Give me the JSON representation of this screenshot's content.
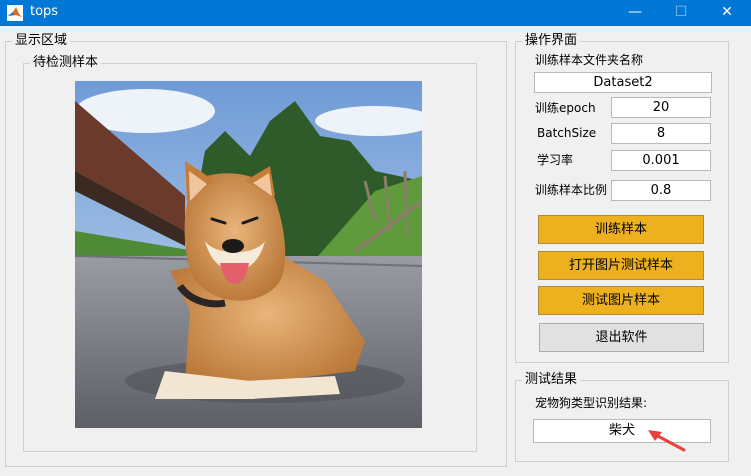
{
  "window": {
    "title": "tops",
    "min_glyph": "—",
    "max_glyph": "☐",
    "close_glyph": "✕"
  },
  "display": {
    "legend": "显示区域",
    "inner_legend": "待检测样本",
    "image_subject": "shiba-inu-photo"
  },
  "ops": {
    "legend": "操作界面",
    "folder_label": "训练样本文件夹名称",
    "folder_value": "Dataset2",
    "epoch_label": "训练epoch",
    "epoch_value": "20",
    "batch_label": "BatchSize",
    "batch_value": "8",
    "lr_label": "学习率",
    "lr_value": "0.001",
    "ratio_label": "训练样本比例",
    "ratio_value": "0.8",
    "train_button": "训练样本",
    "open_button": "打开图片测试样本",
    "test_button": "测试图片样本",
    "exit_button": "退出软件"
  },
  "result": {
    "legend": "测试结果",
    "label": "宠物狗类型识别结果:",
    "value": "柴犬"
  },
  "colors": {
    "titlebar": "#0078d7",
    "accent_button": "#edb120",
    "annotation_arrow": "#e8413a"
  }
}
